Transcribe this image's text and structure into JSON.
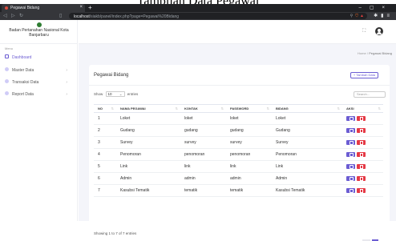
{
  "caption": "Tampilan Data Pegawai",
  "browser": {
    "tab_title": "Pegawai Bidang",
    "url_host": "localhost",
    "url_path": "/siakb/panel/index.php?page=Pegawai%20Bidang"
  },
  "sidebar": {
    "brand": "Badan Pertanahan Nasional Kota Banjarbaru",
    "section_label": "Menu",
    "items": [
      {
        "label": "Dashboard"
      },
      {
        "label": "Master Data"
      },
      {
        "label": "Transaksi Data"
      },
      {
        "label": "Report Data"
      }
    ]
  },
  "breadcrumb": {
    "home": "Home",
    "sep": "/",
    "current": "Pegawai Bidang"
  },
  "card": {
    "title": "Pegawai Bidang",
    "add_label": "+ Tambah Data",
    "show_prefix": "Show",
    "entries_value": "10",
    "show_suffix": "entries",
    "search_placeholder": "Search..."
  },
  "table": {
    "headers": [
      "NO",
      "NAMA PEGAWAI",
      "KONTAK",
      "PASSWORD",
      "BIDANG",
      "AKSI"
    ],
    "rows": [
      [
        "1",
        "Loket",
        "loket",
        "loket",
        "Loket"
      ],
      [
        "2",
        "Gudang",
        "gudang",
        "gudang",
        "Gudang"
      ],
      [
        "3",
        "Survey",
        "survey",
        "survey",
        "Survey"
      ],
      [
        "4",
        "Penomoran",
        "penomoran",
        "penomoran",
        "Penomoran"
      ],
      [
        "5",
        "Link",
        "link",
        "link",
        "Link"
      ],
      [
        "6",
        "Admin",
        "admin",
        "admin",
        "Admin"
      ],
      [
        "7",
        "Kasubsi Tematik",
        "tematik",
        "tematik",
        "Kasubsi Tematik"
      ]
    ]
  },
  "info": "Showing 1 to 7 of 7 entries",
  "colors": {
    "accent": "#6c5dd3",
    "danger": "#e53945"
  }
}
